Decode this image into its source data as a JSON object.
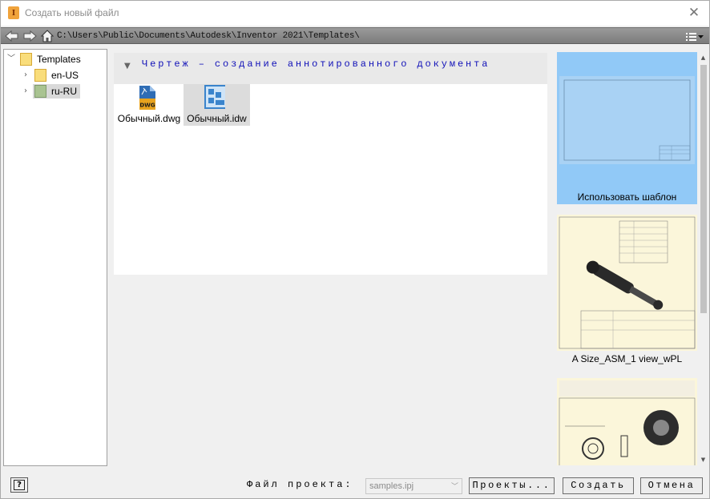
{
  "window": {
    "title": "Создать новый файл",
    "app_icon_glyph": "I",
    "close_glyph": "✕"
  },
  "pathbar": {
    "path": "C:\\Users\\Public\\Documents\\Autodesk\\Inventor 2021\\Templates\\"
  },
  "tree": {
    "items": [
      {
        "label": "Templates",
        "expanded": true,
        "level": 0,
        "selected": false
      },
      {
        "label": "en-US",
        "expanded": false,
        "level": 1,
        "selected": false
      },
      {
        "label": "ru-RU",
        "expanded": false,
        "level": 1,
        "selected": true
      }
    ]
  },
  "templates": {
    "section_title": "Чертеж – создание аннотированного документа",
    "files": [
      {
        "label": "Обычный.dwg",
        "badge": "DWG",
        "selected": false
      },
      {
        "label": "Обычный.idw",
        "selected": true
      }
    ]
  },
  "preview": {
    "cards": [
      {
        "label": "Использовать шаблон",
        "selected": true
      },
      {
        "label": "A Size_ASM_1 view_wPL",
        "selected": false
      },
      {
        "label": "",
        "selected": false
      }
    ]
  },
  "footer": {
    "help_glyph": "?",
    "project_file_label": "Файл проекта:",
    "project_file_value": "samples.ipj",
    "projects_button": "Проекты...",
    "create_button": "Создать",
    "cancel_button": "Отмена"
  },
  "colors": {
    "path_text_accent": "#1010b8",
    "selection_blue": "#91c9f7",
    "pathbar_gray": "#8a8a8a"
  }
}
